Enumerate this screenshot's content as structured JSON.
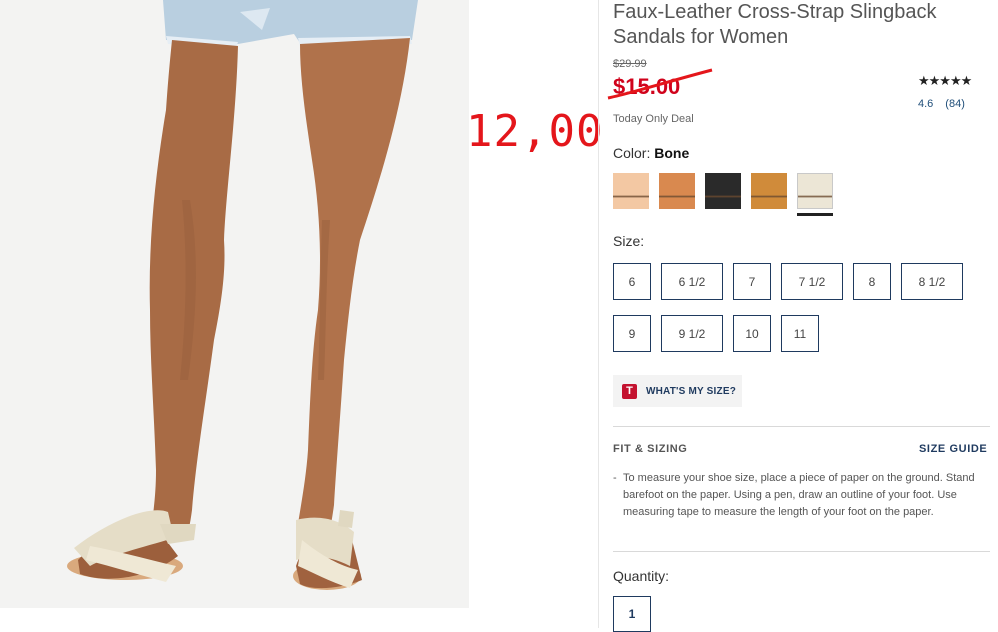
{
  "product": {
    "title": "Faux-Leather Cross-Strap Slingback Sandals for Women",
    "original_price": "$29.99",
    "sale_price": "$15.00",
    "deal_label": "Today Only Deal",
    "handwritten_price": "12,00"
  },
  "rating": {
    "stars": "★★★★★",
    "score": "4.6",
    "count": "(84)"
  },
  "color": {
    "label": "Color:",
    "selected": "Bone",
    "swatches": [
      "#f3c8a3",
      "#d9894f",
      "#2a2a2a",
      "#d08b3a",
      "#ece6d6"
    ]
  },
  "sizes": {
    "label": "Size:",
    "options": [
      "6",
      "6 1/2",
      "7",
      "7 1/2",
      "8",
      "8 1/2",
      "9",
      "9 1/2",
      "10",
      "11"
    ]
  },
  "whats_my_size": {
    "badge": "T",
    "label": "WHAT'S MY SIZE?"
  },
  "fit": {
    "title": "FIT & SIZING",
    "size_guide": "SIZE GUIDE",
    "bullet": "-",
    "text": "To measure your shoe size, place a piece of paper on the ground. Stand barefoot on the paper. Using a pen, draw an outline of your foot. Use measuring tape to measure the length of your foot on the paper."
  },
  "quantity": {
    "label": "Quantity:",
    "value": "1"
  },
  "colors": {
    "accent_navy": "#1f3a5f",
    "sale_red": "#d0021b",
    "annotation_red": "#e4161b"
  }
}
